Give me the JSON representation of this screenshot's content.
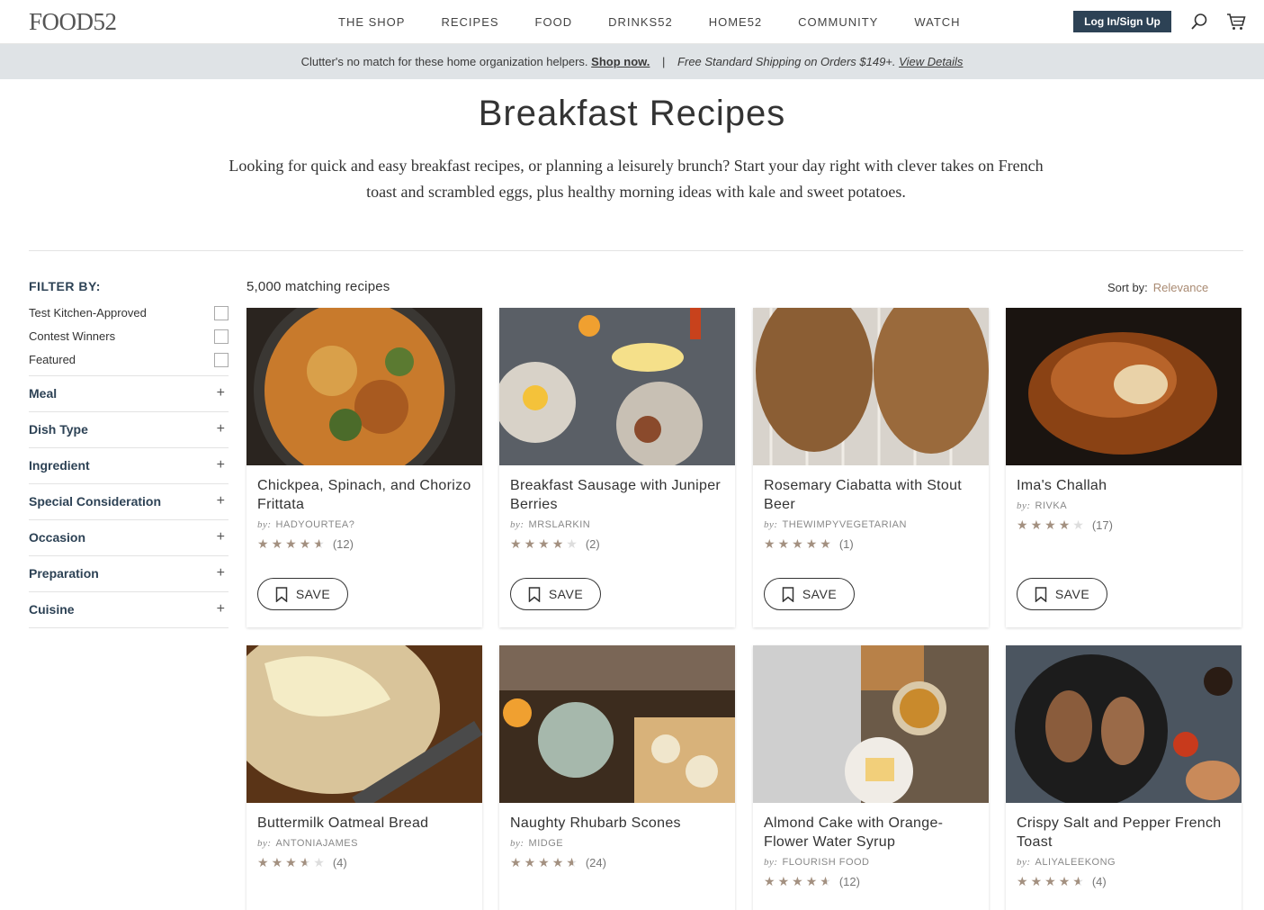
{
  "header": {
    "logo": "FOOD52",
    "nav": [
      "THE SHOP",
      "RECIPES",
      "FOOD",
      "DRINKS52",
      "HOME52",
      "COMMUNITY",
      "WATCH"
    ],
    "login_label": "Log In/Sign Up",
    "search_icon": "search-icon",
    "cart_icon": "cart-icon"
  },
  "promo": {
    "text": "Clutter's no match for these home organization helpers.",
    "cta": "Shop now.",
    "separator": "|",
    "shipping": "Free Standard Shipping on Orders $149+.",
    "details": "View Details"
  },
  "page": {
    "title": "Breakfast Recipes",
    "intro": "Looking for quick and easy breakfast recipes, or planning a leisurely brunch? Start your day right with clever takes on French toast and scrambled eggs, plus healthy morning ideas with kale and sweet potatoes."
  },
  "filters": {
    "heading": "FILTER BY:",
    "checkboxes": [
      "Test Kitchen-Approved",
      "Contest Winners",
      "Featured"
    ],
    "facets": [
      "Meal",
      "Dish Type",
      "Ingredient",
      "Special Consideration",
      "Occasion",
      "Preparation",
      "Cuisine"
    ],
    "expand_symbol": "+"
  },
  "results": {
    "count_label": "5,000 matching recipes",
    "sort_label": "Sort by:",
    "sort_value": "Relevance",
    "by_prefix": "by:",
    "save_label": "SAVE",
    "recipes": [
      {
        "title": "Chickpea, Spinach, and Chorizo Frittata",
        "author": "HADYOURTEA?",
        "rating": 4.5,
        "count": "(12)"
      },
      {
        "title": "Breakfast Sausage with Juniper Berries",
        "author": "MRSLARKIN",
        "rating": 4,
        "count": "(2)"
      },
      {
        "title": "Rosemary Ciabatta with Stout Beer",
        "author": "THEWIMPYVEGETARIAN",
        "rating": 5,
        "count": "(1)"
      },
      {
        "title": "Ima's Challah",
        "author": "RIVKA",
        "rating": 4,
        "count": "(17)"
      },
      {
        "title": "Buttermilk Oatmeal Bread",
        "author": "ANTONIAJAMES",
        "rating": 3.5,
        "count": "(4)"
      },
      {
        "title": "Naughty Rhubarb Scones",
        "author": "MIDGE",
        "rating": 4.5,
        "count": "(24)"
      },
      {
        "title": "Almond Cake with Orange-Flower Water Syrup",
        "author": "FLOURISH FOOD",
        "rating": 4.5,
        "count": "(12)"
      },
      {
        "title": "Crispy Salt and Pepper French Toast",
        "author": "ALIYALEEKONG",
        "rating": 4.5,
        "count": "(4)"
      }
    ]
  },
  "colors": {
    "brand_navy": "#2d4255",
    "promo_bg": "#dfe3e6",
    "star": "#a39080",
    "sort_accent": "#a98a72"
  }
}
